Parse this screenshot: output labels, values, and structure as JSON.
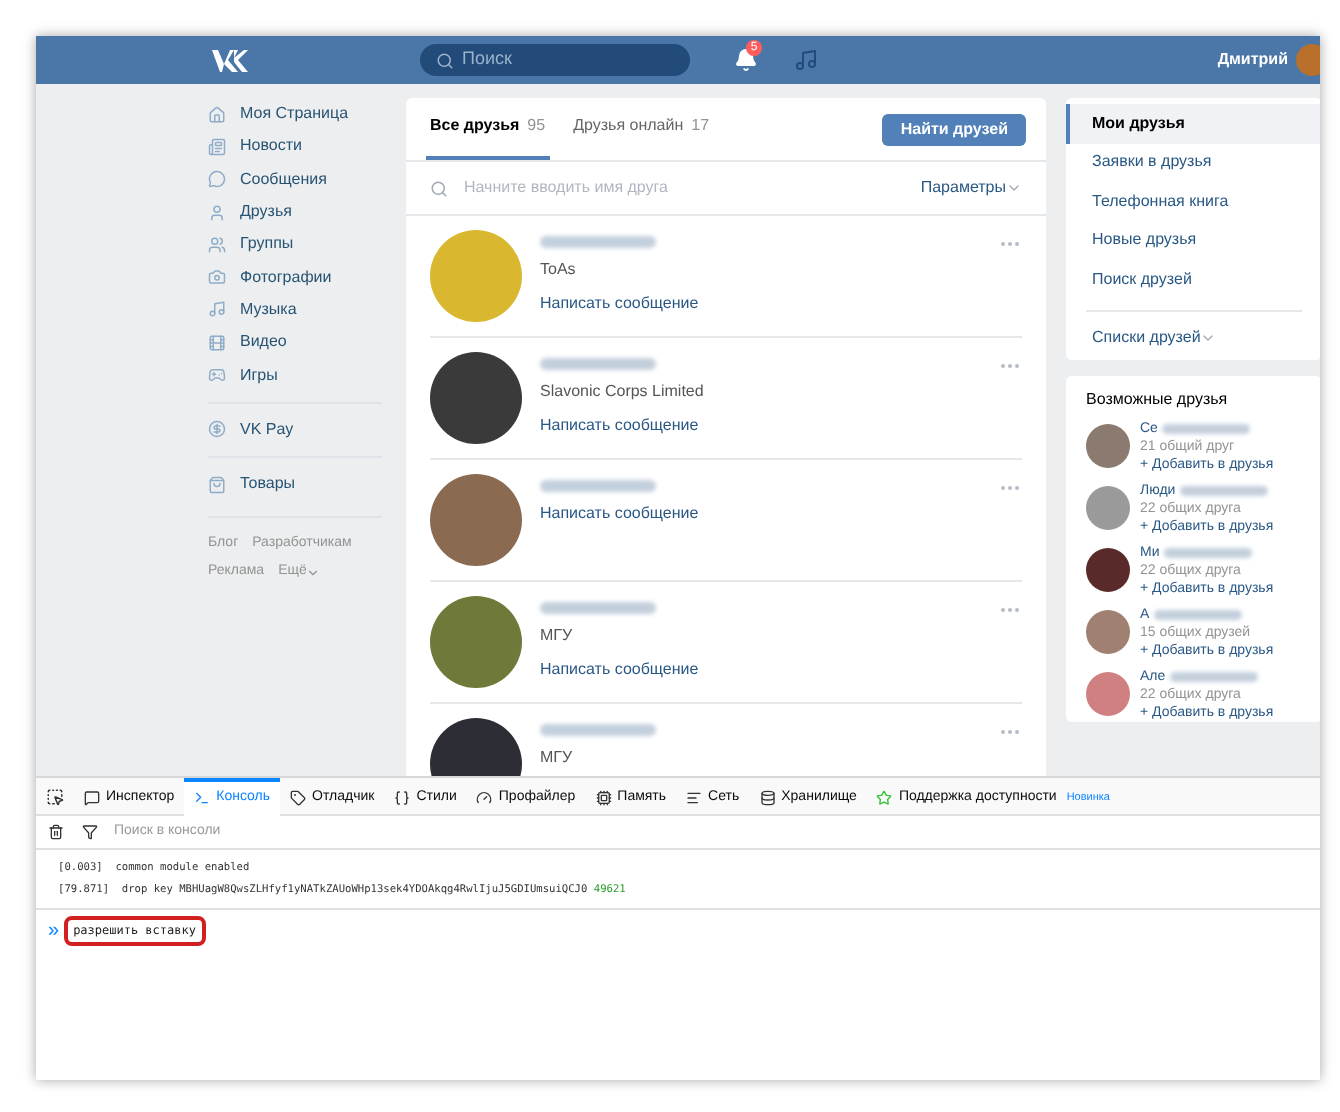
{
  "header": {
    "search_placeholder": "Поиск",
    "notification_count": "5",
    "user_name": "Дмитрий"
  },
  "left_menu": {
    "groups": [
      [
        "Моя Страница",
        "Новости",
        "Сообщения",
        "Друзья",
        "Группы",
        "Фотографии",
        "Музыка",
        "Видео",
        "Игры"
      ],
      [
        "VK Pay"
      ],
      [
        "Товары"
      ]
    ],
    "footer_links": [
      "Блог",
      "Разработчикам",
      "Реклама",
      "Ещё"
    ]
  },
  "friends": {
    "tabs": [
      {
        "label": "Все друзья",
        "count": "95",
        "selected": true
      },
      {
        "label": "Друзья онлайн",
        "count": "17",
        "selected": false
      }
    ],
    "find_button": "Найти друзей",
    "search_placeholder": "Начните вводить имя друга",
    "params": "Параметры",
    "rows": [
      {
        "subtitle": "ToAs",
        "action": "Написать сообщение"
      },
      {
        "subtitle": "Slavonic Corps Limited",
        "action": "Написать сообщение"
      },
      {
        "action": "Написать сообщение"
      },
      {
        "subtitle": "МГУ",
        "action": "Написать сообщение"
      },
      {
        "subtitle": "МГУ"
      }
    ]
  },
  "right_menu": {
    "items": [
      {
        "label": "Мои друзья",
        "selected": true
      },
      {
        "label": "Заявки в друзья",
        "selected": false
      },
      {
        "label": "Телефонная книга",
        "selected": false
      },
      {
        "label": "Новые друзья",
        "selected": false
      },
      {
        "label": "Поиск друзей",
        "selected": false
      }
    ],
    "lists": "Списки друзей"
  },
  "suggestions": {
    "title": "Возможные друзья",
    "items": [
      {
        "name": "Се",
        "mutual": "21 общий друг",
        "action": "+ Добавить в друзья"
      },
      {
        "name": "Люди",
        "mutual": "22 общих друга",
        "action": "+ Добавить в друзья"
      },
      {
        "name": "Ми",
        "mutual": "22 общих друга",
        "action": "+ Добавить в друзья"
      },
      {
        "name": "А",
        "mutual": "15 общих друзей",
        "action": "+ Добавить в друзья"
      },
      {
        "name": "Але",
        "mutual": "22 общих друга",
        "action": "+ Добавить в друзья"
      }
    ]
  },
  "devtools": {
    "tabs": [
      {
        "label": "Инспектор",
        "selected": false
      },
      {
        "label": "Консоль",
        "selected": true
      },
      {
        "label": "Отладчик",
        "selected": false
      },
      {
        "label": "Стили",
        "selected": false
      },
      {
        "label": "Профайлер",
        "selected": false
      },
      {
        "label": "Память",
        "selected": false
      },
      {
        "label": "Сеть",
        "selected": false
      },
      {
        "label": "Хранилище",
        "selected": false
      },
      {
        "label": "Поддержка доступности",
        "selected": false,
        "badge": "Новинка"
      }
    ],
    "filter_placeholder": "Поиск в консоли",
    "log": [
      {
        "time": "[0.003]",
        "text": "common module enabled"
      },
      {
        "time": "[79.871]",
        "text": "drop key MBHUagW8QwsZLHfyf1yNATkZAUoWHp13sek4YDOAkqg4RwlIjuJ5GDIUmsuiQCJ0",
        "number": "49621"
      }
    ],
    "prompt": "»",
    "input": "разрешить вставку"
  }
}
